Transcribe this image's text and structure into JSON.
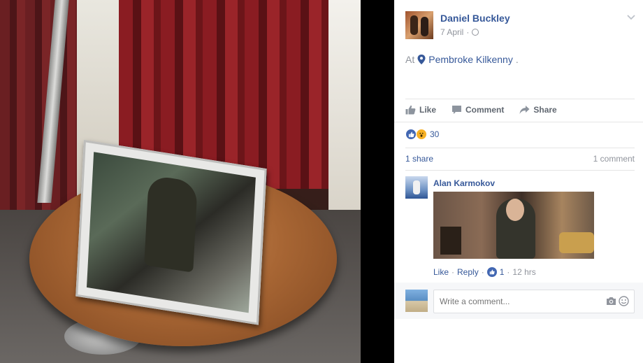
{
  "post": {
    "author": "Daniel Buckley",
    "date": "7 April",
    "meta_sep": "·",
    "location_prefix": "At",
    "location": "Pembroke Kilkenny",
    "location_suffix": "."
  },
  "actions": {
    "like": "Like",
    "comment": "Comment",
    "share": "Share"
  },
  "reactions": {
    "count": "30"
  },
  "stats": {
    "shares": "1 share",
    "comments": "1 comment"
  },
  "comment": {
    "author": "Alan Karmokov",
    "like": "Like",
    "sep1": "·",
    "reply": "Reply",
    "sep2": "·",
    "likes": "1",
    "sep3": "·",
    "time": "12 hrs"
  },
  "composer": {
    "placeholder": "Write a comment..."
  },
  "icons": {
    "privacy": "globe-icon",
    "location": "pin-icon",
    "like": "thumbs-up-icon",
    "comment": "speech-bubble-icon",
    "share": "share-arrow-icon",
    "camera": "camera-icon",
    "emoji": "smile-icon"
  },
  "colors": {
    "link": "#365899",
    "muted": "#90949c",
    "like_blue": "#4267b2",
    "wow_yellow": "#f7b125"
  }
}
